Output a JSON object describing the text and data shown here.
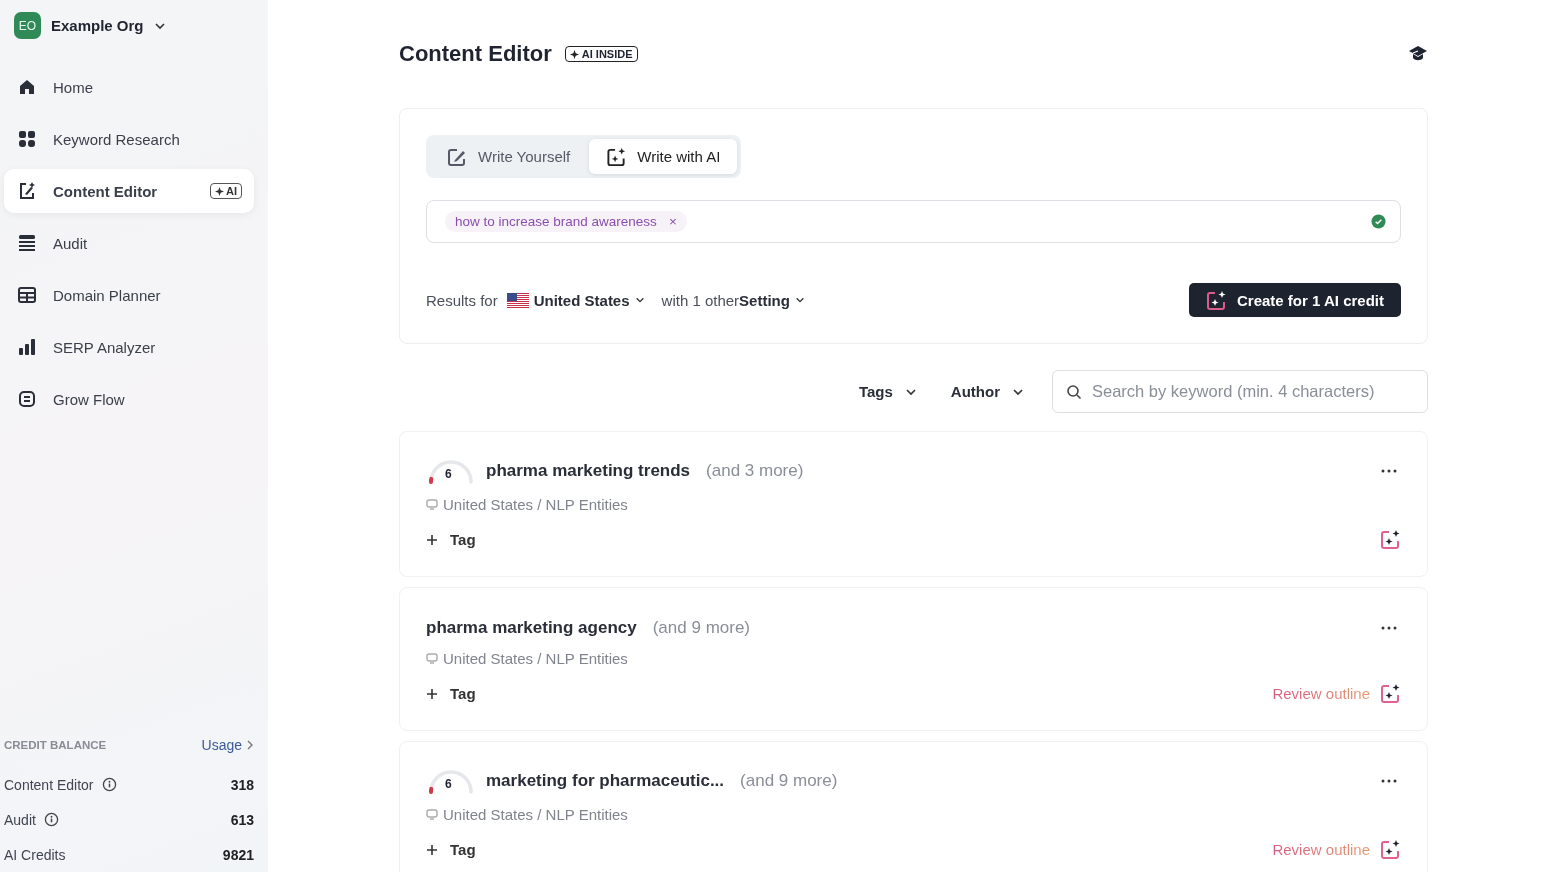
{
  "org": {
    "initials": "EO",
    "name": "Example Org"
  },
  "nav": [
    {
      "label": "Home",
      "selected": false
    },
    {
      "label": "Keyword Research",
      "selected": false
    },
    {
      "label": "Content Editor",
      "selected": true,
      "badge": "AI"
    },
    {
      "label": "Audit",
      "selected": false
    },
    {
      "label": "Domain Planner",
      "selected": false
    },
    {
      "label": "SERP Analyzer",
      "selected": false
    },
    {
      "label": "Grow Flow",
      "selected": false
    }
  ],
  "credits": {
    "title": "CREDIT BALANCE",
    "link": "Usage",
    "rows": [
      {
        "label": "Content Editor",
        "info": true,
        "value": "318"
      },
      {
        "label": "Audit",
        "info": true,
        "value": "613"
      },
      {
        "label": "AI Credits",
        "info": false,
        "value": "9821"
      }
    ]
  },
  "header": {
    "title": "Content Editor",
    "badge": "AI INSIDE"
  },
  "modes": [
    {
      "label": "Write Yourself",
      "selected": false
    },
    {
      "label": "Write with AI",
      "selected": true
    }
  ],
  "keyword_field": {
    "chips": [
      {
        "text": "how to increase brand awareness",
        "remove": "×"
      }
    ],
    "valid": true
  },
  "results": {
    "prefix": "Results for",
    "country": "United States",
    "middle": "with 1 other",
    "setting": "Setting"
  },
  "create_button": "Create for 1 AI credit",
  "filters": [
    {
      "label": "Tags"
    },
    {
      "label": "Author"
    }
  ],
  "search": {
    "placeholder": "Search by keyword (min. 4 characters)"
  },
  "documents": [
    {
      "score": "6",
      "level": 0.05,
      "title": "pharma marketing trends",
      "more": "(and 3 more)",
      "location": "United States / NLP Entities",
      "tag": "Tag"
    },
    {
      "title": "pharma marketing agency",
      "more": "(and 9 more)",
      "location": "United States / NLP Entities",
      "tag": "Tag",
      "review": "Review outline"
    },
    {
      "score": "6",
      "level": 0.05,
      "title": "marketing for pharmaceutic...",
      "more": "(and 9 more)",
      "location": "United States / NLP Entities",
      "tag": "Tag",
      "review": "Review outline"
    }
  ]
}
